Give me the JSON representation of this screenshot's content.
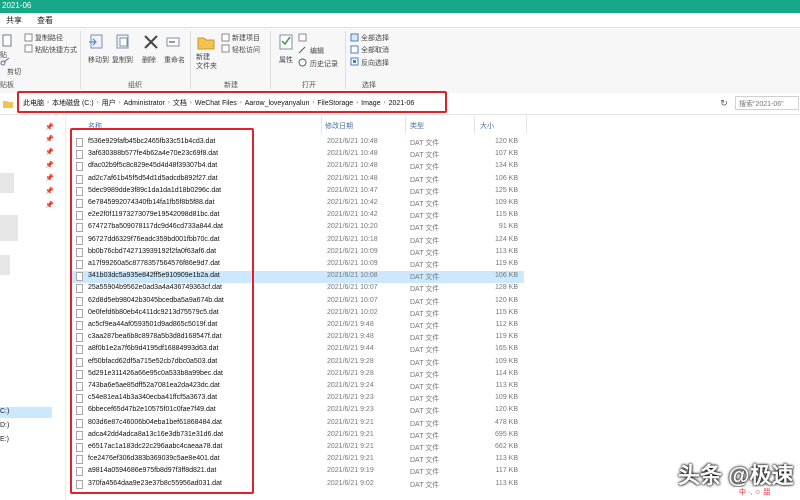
{
  "window": {
    "title": "2021-06"
  },
  "tabs": [
    "共享",
    "查看"
  ],
  "ribbon": {
    "clipboard": {
      "copy_path": "复制路径",
      "paste_shortcut": "粘贴快捷方式",
      "cut": "剪切",
      "group": "贴板"
    },
    "organize": {
      "move_to": "移动到",
      "copy_to": "复制到",
      "delete": "删除",
      "rename": "重命名",
      "group": "组织"
    },
    "new": {
      "new_item": "新建项目",
      "easy_access": "轻松访问",
      "new_folder": "新建\n文件夹",
      "group": "新建"
    },
    "open": {
      "properties": "属性",
      "open_btn": "打开",
      "edit": "编辑",
      "history": "历史记录",
      "group": "打开"
    },
    "select": {
      "select_all": "全部选择",
      "select_none": "全部取消",
      "invert": "反向选择",
      "group": "选择"
    }
  },
  "address": {
    "crumbs": [
      "此电脑",
      "本地磁盘 (C:)",
      "用户",
      "Administrator",
      "文档",
      "WeChat Files",
      "Aarow_loveyanyalun",
      "FileStorage",
      "Image",
      "2021-06"
    ],
    "search_placeholder": "搜索\"2021-06\""
  },
  "nav": {
    "drive_c": "C:)",
    "drive_d": "D:)",
    "drive_e": "E:)"
  },
  "columns": {
    "name": "名称",
    "date": "修改日期",
    "type": "类型",
    "size": "大小"
  },
  "files": [
    {
      "name": "f536e929fafb45bc2465fb33c51b4cd3.dat",
      "date": "2021/6/21 10:48",
      "type": "DAT 文件",
      "size": "120 KB"
    },
    {
      "name": "3af630388b577fe4b62a4e70e23c69f8.dat",
      "date": "2021/6/21 10:48",
      "type": "DAT 文件",
      "size": "107 KB"
    },
    {
      "name": "dfac02b9f5c8c829e45d4d48f39307b4.dat",
      "date": "2021/6/21 10:48",
      "type": "DAT 文件",
      "size": "134 KB"
    },
    {
      "name": "ad2c7af61b45f5d54d1d5adcdb892f27.dat",
      "date": "2021/6/21 10:48",
      "type": "DAT 文件",
      "size": "106 KB"
    },
    {
      "name": "5dec9989dde3f89c1da1da1d18b0296c.dat",
      "date": "2021/6/21 10:47",
      "type": "DAT 文件",
      "size": "125 KB"
    },
    {
      "name": "6e7845992074340fb14fa1fb5f8b5f88.dat",
      "date": "2021/6/21 10:42",
      "type": "DAT 文件",
      "size": "109 KB"
    },
    {
      "name": "e2e2f0f11973273079e19542098d81bc.dat",
      "date": "2021/6/21 10:42",
      "type": "DAT 文件",
      "size": "115 KB"
    },
    {
      "name": "674727ba509078117dc9d46cd733a844.dat",
      "date": "2021/6/21 10:20",
      "type": "DAT 文件",
      "size": "91 KB"
    },
    {
      "name": "96727dd6329f76eadc359bd001fbb70c.dat",
      "date": "2021/6/21 10:18",
      "type": "DAT 文件",
      "size": "124 KB"
    },
    {
      "name": "bb0b76cbd742713939192f2fa0f63af6.dat",
      "date": "2021/6/21 10:09",
      "type": "DAT 文件",
      "size": "113 KB"
    },
    {
      "name": "a17f99260a5c8778357564576f86e9d7.dat",
      "date": "2021/6/21 10:09",
      "type": "DAT 文件",
      "size": "119 KB"
    },
    {
      "name": "341b03dc5a935e842ff5e910909e1b2a.dat",
      "date": "2021/6/21 10:08",
      "type": "DAT 文件",
      "size": "106 KB"
    },
    {
      "name": "25a55904b9562e0ad3a4a436749363cf.dat",
      "date": "2021/6/21 10:07",
      "type": "DAT 文件",
      "size": "128 KB"
    },
    {
      "name": "62d8d5eb98042b3045bcedba5a9a674b.dat",
      "date": "2021/6/21 10:07",
      "type": "DAT 文件",
      "size": "120 KB"
    },
    {
      "name": "0e0fefd6b80eb4c411dc9213d75579c5.dat",
      "date": "2021/6/21 10:02",
      "type": "DAT 文件",
      "size": "115 KB"
    },
    {
      "name": "ac5cf9ea44af0593501d9ad865c5019f.dat",
      "date": "2021/6/21 9:48",
      "type": "DAT 文件",
      "size": "112 KB"
    },
    {
      "name": "c3aa287bea6b8c8978a5b3d8d168547f.dat",
      "date": "2021/6/21 9:48",
      "type": "DAT 文件",
      "size": "119 KB"
    },
    {
      "name": "a8f0b1e2a7f6b9d4195df16884993d63.dat",
      "date": "2021/6/21 9:44",
      "type": "DAT 文件",
      "size": "165 KB"
    },
    {
      "name": "ef50bfacd62df5a715e52cb7dbc0a503.dat",
      "date": "2021/6/21 9:28",
      "type": "DAT 文件",
      "size": "109 KB"
    },
    {
      "name": "5d291e311426a66e95c0a533b8a99bec.dat",
      "date": "2021/6/21 9:28",
      "type": "DAT 文件",
      "size": "114 KB"
    },
    {
      "name": "743ba6e5ae85dff52a7081ea2da423dc.dat",
      "date": "2021/6/21 9:24",
      "type": "DAT 文件",
      "size": "113 KB"
    },
    {
      "name": "c54e81ea14b3a340ecba41ffcf5a3673.dat",
      "date": "2021/6/21 9:23",
      "type": "DAT 文件",
      "size": "109 KB"
    },
    {
      "name": "6bbecef65d47b2e10575f01c0fae7f49.dat",
      "date": "2021/6/21 9:23",
      "type": "DAT 文件",
      "size": "120 KB"
    },
    {
      "name": "803d6e87c46006b04eba1bef61868484.dat",
      "date": "2021/6/21 9:21",
      "type": "DAT 文件",
      "size": "478 KB"
    },
    {
      "name": "adca42dd4adca8a13c16e3db731e31d6.dat",
      "date": "2021/6/21 9:21",
      "type": "DAT 文件",
      "size": "695 KB"
    },
    {
      "name": "e6517ac1a183dc22c296aabc4caeaa78.dat",
      "date": "2021/6/21 9:21",
      "type": "DAT 文件",
      "size": "662 KB"
    },
    {
      "name": "fce2476ef306d383b369039c5ae8e401.dat",
      "date": "2021/6/21 9:21",
      "type": "DAT 文件",
      "size": "113 KB"
    },
    {
      "name": "a9814a0594686e975fb8d97f3ff8d821.dat",
      "date": "2021/6/21 9:19",
      "type": "DAT 文件",
      "size": "117 KB"
    },
    {
      "name": "370fa4564daa9e23e37b8c55956ad031.dat",
      "date": "2021/6/21 9:02",
      "type": "DAT 文件",
      "size": "113 KB"
    }
  ],
  "selected_index": 11,
  "watermark": "头条 @极速",
  "badge": "中 ·, ☺ 㗊"
}
